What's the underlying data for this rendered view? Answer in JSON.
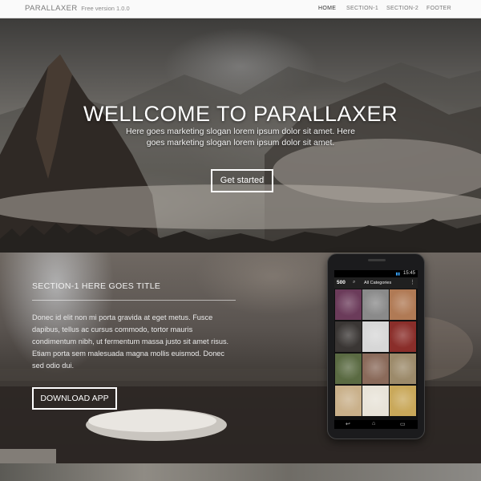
{
  "navbar": {
    "brand": "PARALLAXER",
    "version": "Free version 1.0.0",
    "items": [
      {
        "label": "HOME",
        "active": true
      },
      {
        "label": "SECTION-1",
        "active": false
      },
      {
        "label": "SECTION-2",
        "active": false
      },
      {
        "label": "FOOTER",
        "active": false
      }
    ]
  },
  "hero": {
    "title": "WELLCOME TO PARALLAXER",
    "slogan": "Here goes marketing slogan lorem ipsum dolor sit amet. Here goes marketing slogan lorem ipsum dolor sit amet.",
    "button_label": "Get started"
  },
  "section1": {
    "title": "SECTION-1 HERE GOES TITLE",
    "body": "Donec id elit non mi porta gravida at eget metus. Fusce dapibus, tellus ac cursus commodo, tortor mauris condimentum nibh, ut fermentum massa justo sit amet risus. Etiam porta sem malesuada magna mollis euismod. Donec sed odio dui.",
    "button_label": "DOWNLOAD APP"
  },
  "phone": {
    "time": "15:45",
    "app_logo": "500",
    "category": "All Categories",
    "tile_colors": [
      "#6b3b5a",
      "#8a8a8a",
      "#b07a55",
      "#3a3634",
      "#d7d7d7",
      "#8a2e2a",
      "#5a6a42",
      "#8a6a5a",
      "#9c8a6a",
      "#c9b08a",
      "#e8e3d8",
      "#c9a85a"
    ],
    "icons": [
      "search-icon",
      "menu-icon",
      "back-icon",
      "home-icon",
      "recents-icon"
    ]
  }
}
